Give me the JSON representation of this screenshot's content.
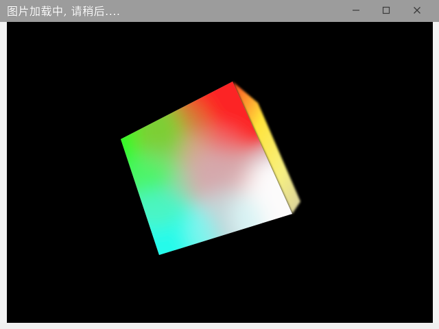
{
  "window": {
    "title_overlay": "图片加载中, 请稍后....",
    "controls": {
      "minimize_icon": "minimize-icon",
      "maximize_icon": "maximize-icon",
      "close_icon": "close-icon"
    }
  },
  "scene": {
    "background_color": "#000000",
    "object": "rgb-color-cube",
    "corner_colors": {
      "red": "#ff1a1a",
      "green": "#1aff1a",
      "cyan": "#1affee",
      "white": "#ffffff",
      "yellow": "#ffff33"
    }
  },
  "colors": {
    "titlebar": "#9c9c9c",
    "frame": "#f3f3f3"
  }
}
